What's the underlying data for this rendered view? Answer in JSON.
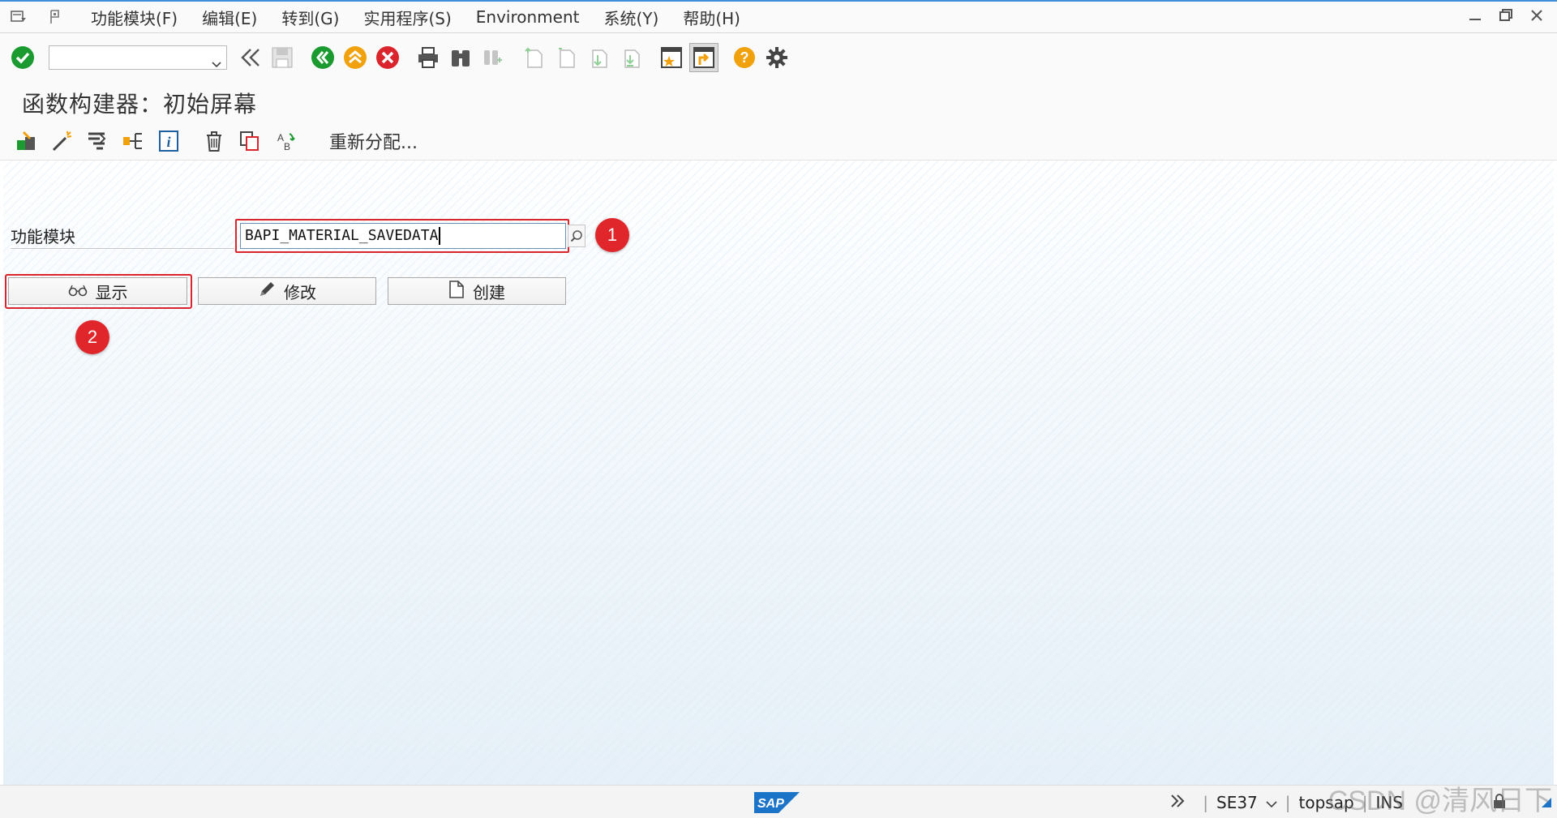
{
  "menubar": {
    "items": [
      "功能模块(F)",
      "编辑(E)",
      "转到(G)",
      "实用程序(S)",
      "Environment",
      "系统(Y)",
      "帮助(H)"
    ]
  },
  "toolbar": {
    "okcode_value": ""
  },
  "title": "函数构建器：初始屏幕",
  "app_toolbar": {
    "reassign_label": "重新分配..."
  },
  "form": {
    "function_module_label": "功能模块",
    "function_module_value": "BAPI_MATERIAL_SAVEDATA"
  },
  "buttons": {
    "display": "显示",
    "change": "修改",
    "create": "创建"
  },
  "badges": {
    "one": "1",
    "two": "2"
  },
  "statusbar": {
    "logo": "SAP",
    "transaction": "SE37",
    "system": "topsap",
    "mode": "INS"
  },
  "watermark": "CSDN @清风日下",
  "colors": {
    "accent_blue": "#3c8fd8",
    "highlight_red": "#d9252b",
    "ok_green": "#1a9a2f",
    "back_green": "#1a9a2f",
    "exit_orange": "#f0a10b",
    "cancel_red": "#d9252b",
    "help_orange": "#f0a10b"
  }
}
